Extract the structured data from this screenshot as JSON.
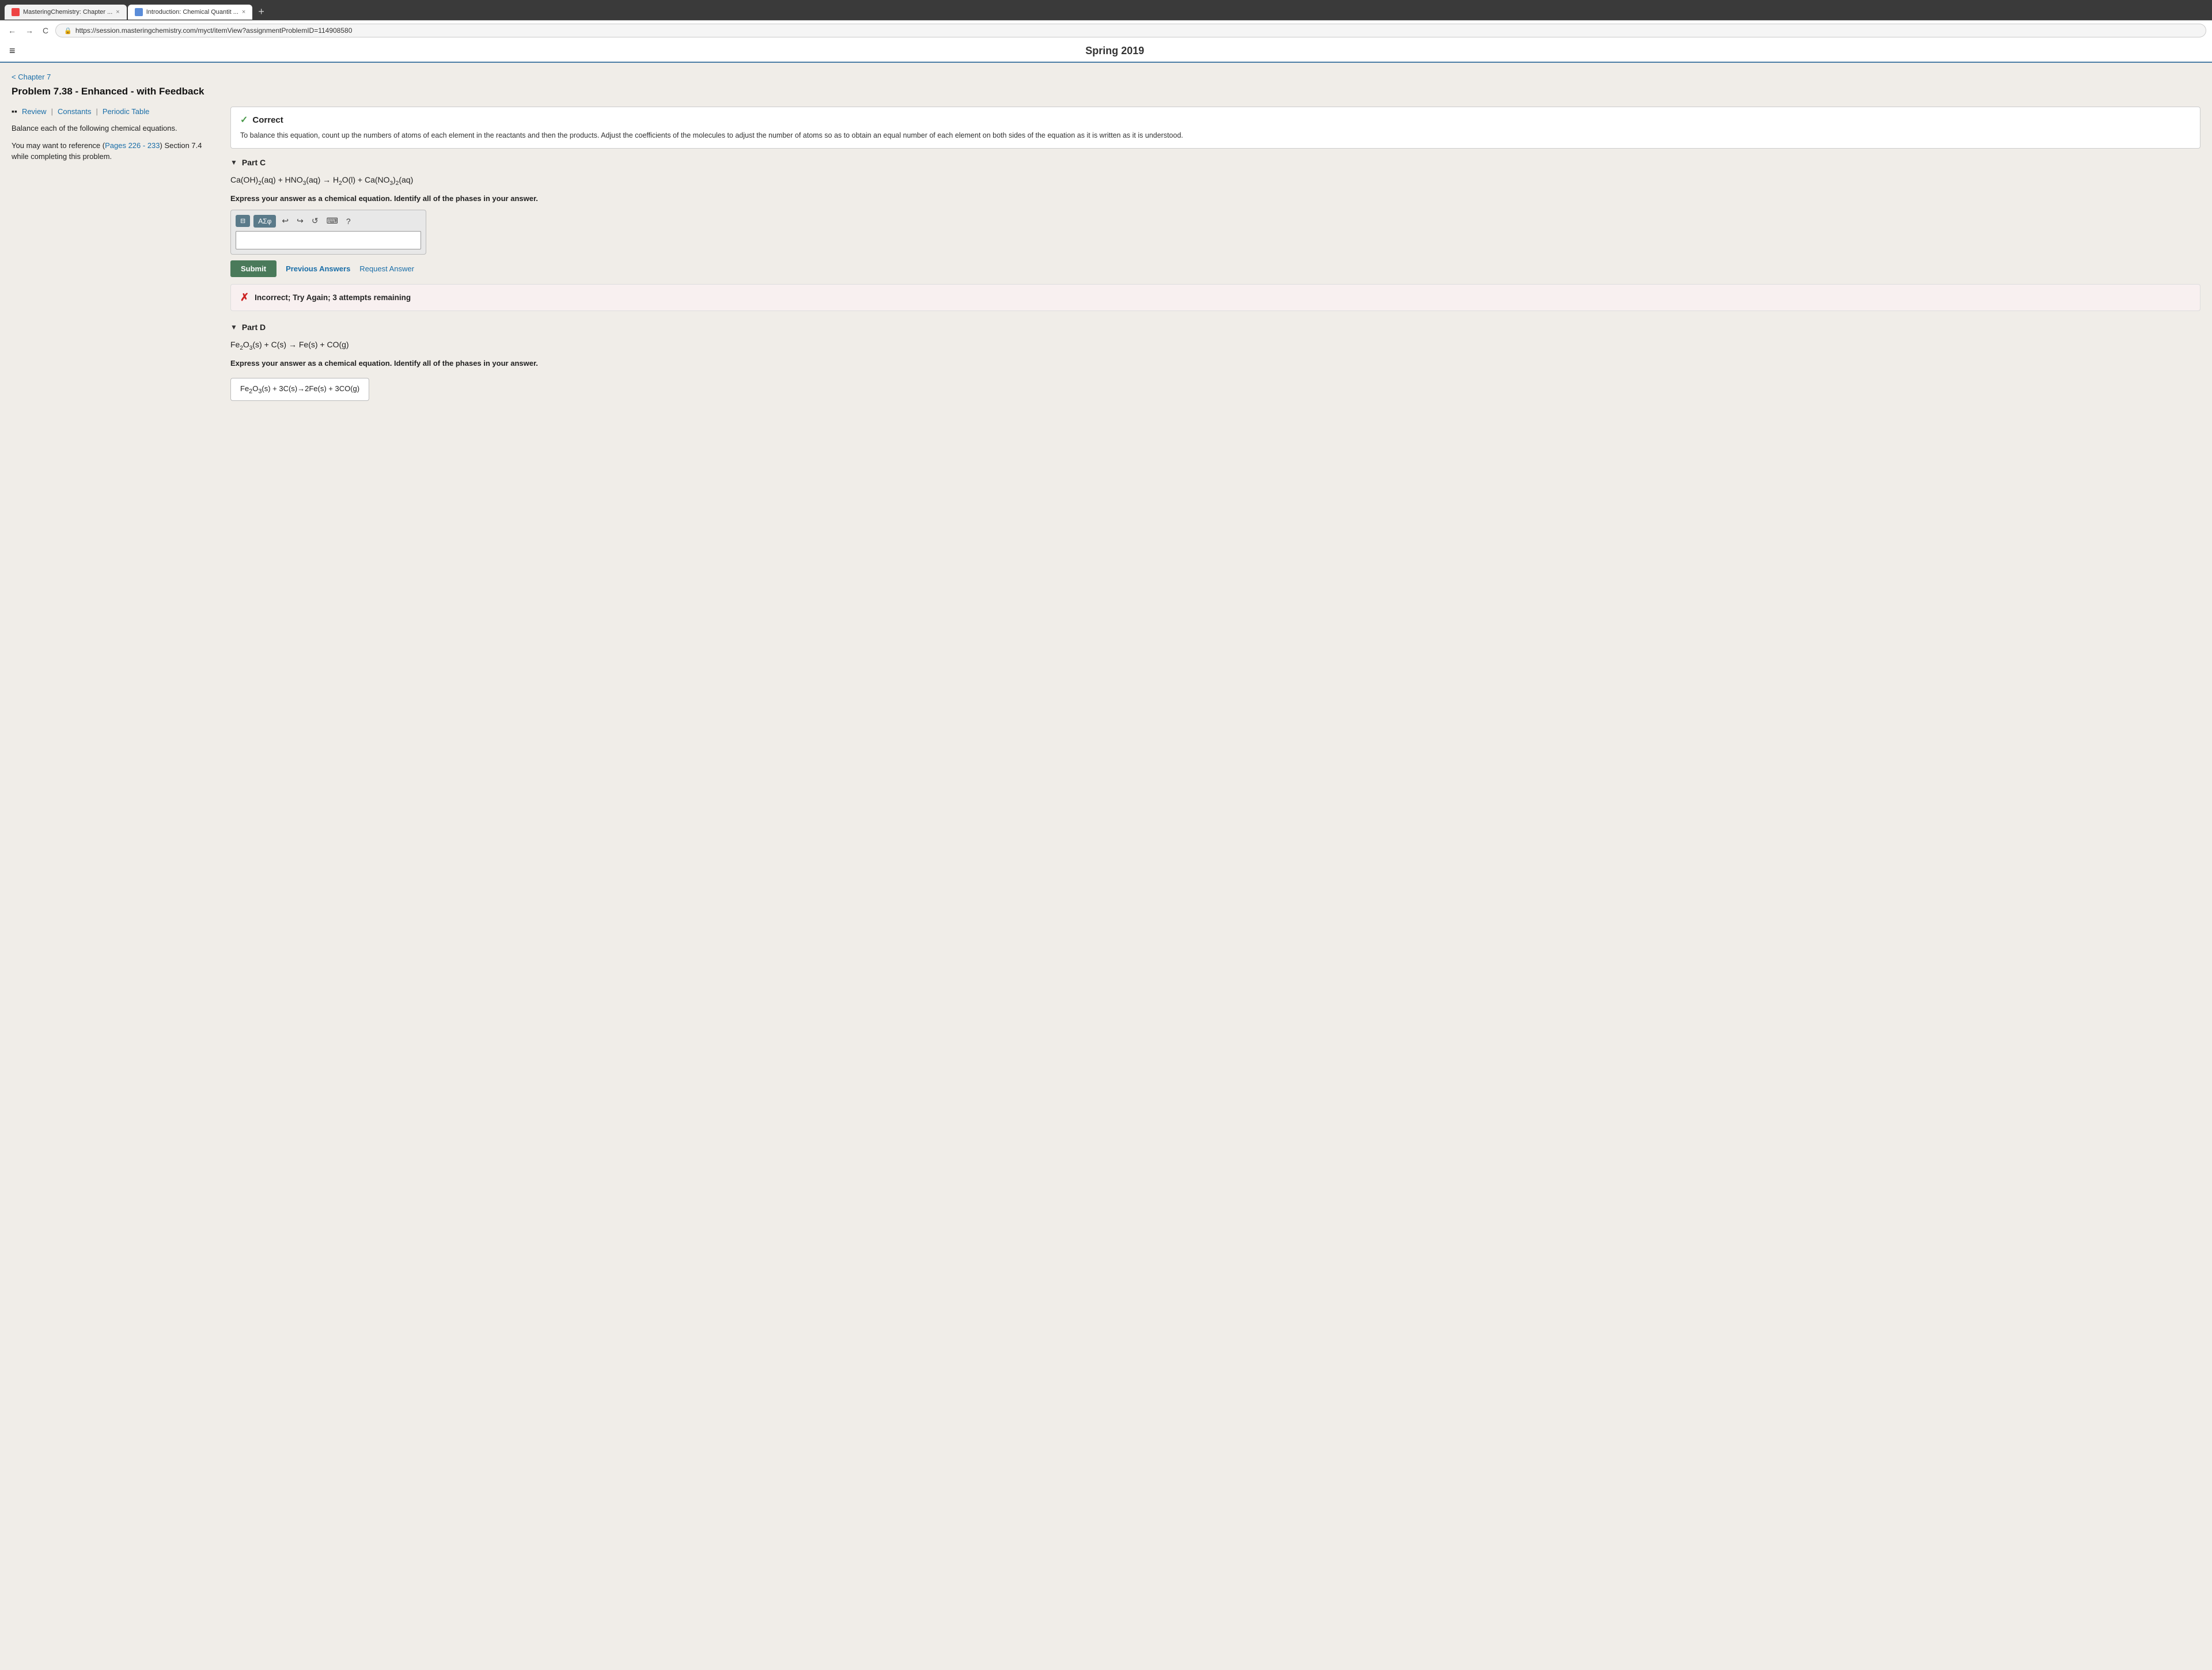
{
  "browser": {
    "tabs": [
      {
        "id": "tab1",
        "favicon_type": "red",
        "title": "MasteringChemistry: Chapter ...",
        "active": false,
        "close_label": "×"
      },
      {
        "id": "tab2",
        "favicon_type": "blue",
        "title": "Introduction: Chemical Quantit ...",
        "active": true,
        "close_label": "×"
      }
    ],
    "new_tab_label": "+",
    "nav": {
      "back": "←",
      "forward": "→",
      "reload": "C"
    },
    "url": "https://session.masteringchemistry.com/myct/itemView?assignmentProblemID=114908580",
    "lock_icon": "🔒"
  },
  "header": {
    "hamburger": "≡",
    "title": "Spring 2019"
  },
  "page": {
    "chapter_link": "< Chapter 7",
    "problem_title": "Problem 7.38 - Enhanced - with Feedback",
    "resources": {
      "book_icon": "▪▪",
      "review": "Review",
      "sep1": "|",
      "constants": "Constants",
      "sep2": "|",
      "periodic_table": "Periodic Table"
    },
    "left_text1": "Balance each of the following chemical equations.",
    "left_text2": "You may want to reference (Pages 226 - 233) Section 7.4 while completing this problem.",
    "correct_section": {
      "check_icon": "✓",
      "label": "Correct",
      "text": "To balance this equation, count up the numbers of atoms of each element in the reactants and then the products. Adjust the coefficients of the molecules to adjust the number of atoms so as to obtain an equal number of each element on both sides of the equation as it is written as it is understood."
    },
    "part_c": {
      "arrow": "▼",
      "label": "Part C",
      "equation_html": "Ca(OH)₂(aq) + HNO₃(aq) → H₂O(l) + Ca(NO₃)₂(aq)",
      "express_text": "Express your answer as a chemical equation. Identify all of the phases in your answer.",
      "toolbar": {
        "template_icon": "⊟",
        "symbol_btn": "ΑΣφ",
        "undo": "↩",
        "redo": "↪",
        "reset": "↺",
        "keyboard": "⌨",
        "help": "?"
      },
      "input_placeholder": "",
      "submit_label": "Submit",
      "prev_answers_label": "Previous Answers",
      "request_answer_label": "Request Answer",
      "incorrect_label": "Incorrect; Try Again; 3 attempts remaining"
    },
    "part_d": {
      "arrow": "▼",
      "label": "Part D",
      "equation_html": "Fe₂O₃(s) + C(s) → Fe(s) + CO(g)",
      "express_text": "Express your answer as a chemical equation. Identify all of the phases in your answer.",
      "answer_display": "Fe₂O₃(s) + 3C(s)→2Fe(s) + 3CO(g)"
    }
  }
}
